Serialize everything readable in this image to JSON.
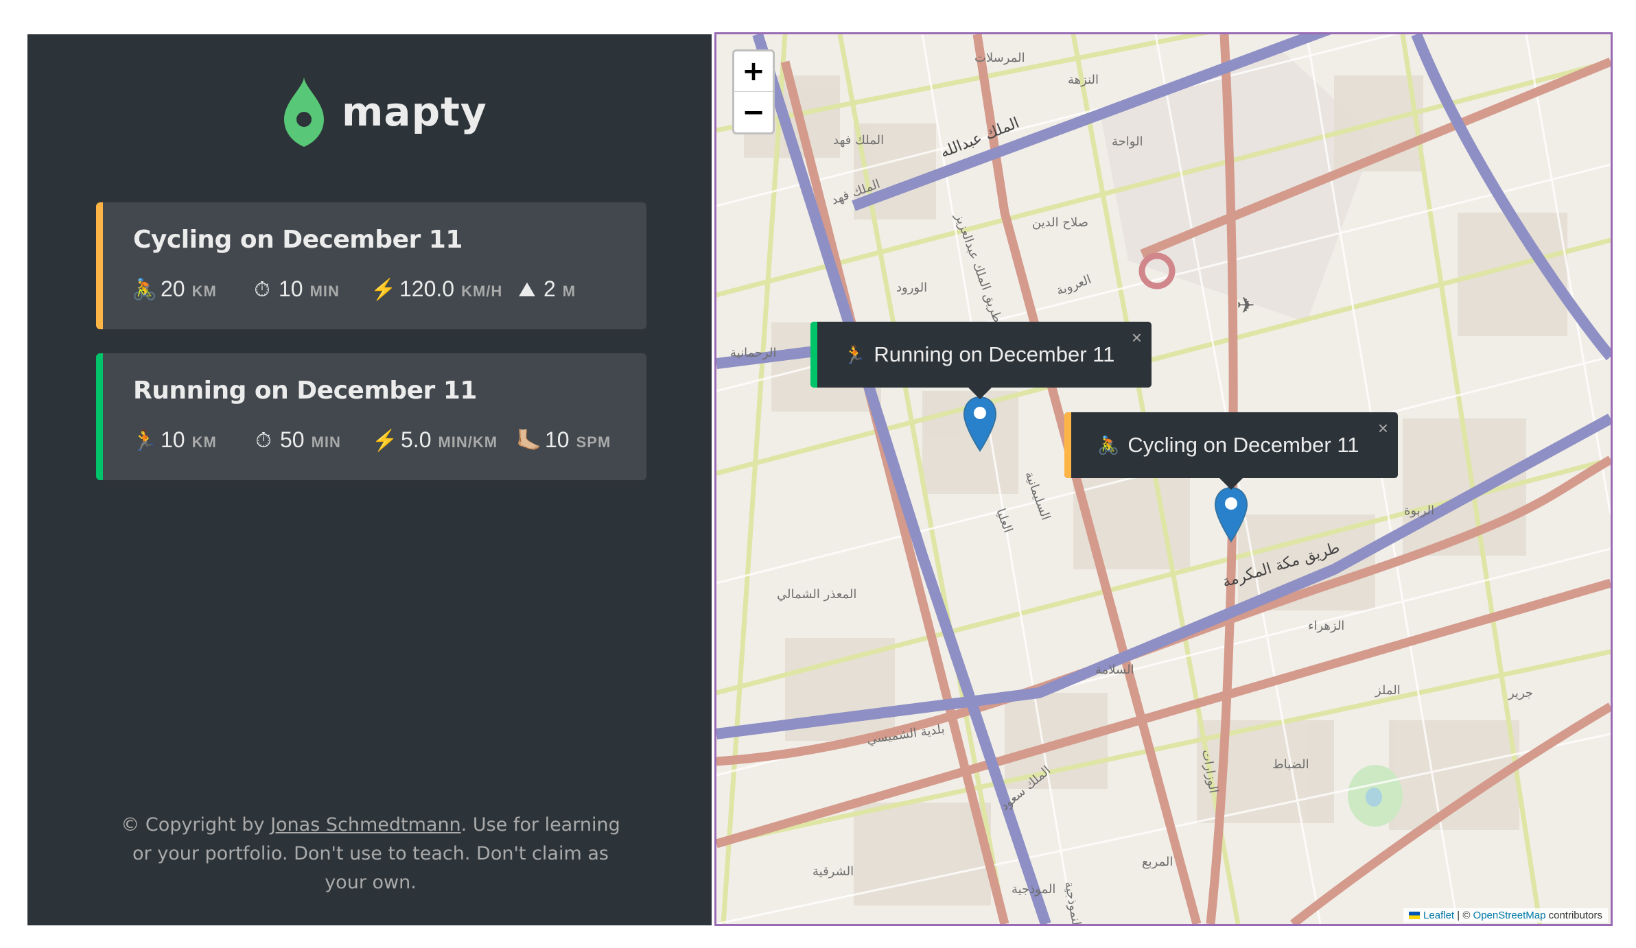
{
  "logo": {
    "text": "mapty",
    "pin_color": "#58c777"
  },
  "colors": {
    "sidebar_bg": "#2d3439",
    "card_bg": "#42484d",
    "cycling_accent": "#ffb545",
    "running_accent": "#00c46a",
    "map_border": "#9a6bb5"
  },
  "workouts": [
    {
      "type": "cycling",
      "title": "Cycling on December 11",
      "details": [
        {
          "icon": "🚴",
          "value": "20",
          "unit": "KM"
        },
        {
          "icon": "⏱",
          "value": "10",
          "unit": "MIN"
        },
        {
          "icon": "⚡️",
          "value": "120.0",
          "unit": "KM/H"
        },
        {
          "icon": "⛰",
          "value": "2",
          "unit": "M"
        }
      ]
    },
    {
      "type": "running",
      "title": "Running on December 11",
      "details": [
        {
          "icon": "🏃",
          "value": "10",
          "unit": "KM"
        },
        {
          "icon": "⏱",
          "value": "50",
          "unit": "MIN"
        },
        {
          "icon": "⚡️",
          "value": "5.0",
          "unit": "MIN/KM"
        },
        {
          "icon": "🦶🏼",
          "value": "10",
          "unit": "SPM"
        }
      ]
    }
  ],
  "copyright": {
    "prefix": "© Copyright by ",
    "author": "Jonas Schmedtmann",
    "suffix": ". Use for learning or your portfolio. Don't use to teach. Don't claim as your own."
  },
  "map": {
    "zoom_in": "+",
    "zoom_out": "−",
    "popups": [
      {
        "icon": "🏃",
        "text": "Running on December 11",
        "close": "×"
      },
      {
        "icon": "🚴",
        "text": "Cycling on December 11",
        "close": "×"
      }
    ],
    "attribution": {
      "leaflet": "Leaflet",
      "separator": " | © ",
      "osm": "OpenStreetMap",
      "suffix": " contributors"
    },
    "labels": [
      "المرسلات",
      "النزهة",
      "الملك فهد",
      "الملك عبدالله",
      "الواحة",
      "صلاح الدين",
      "العروبة",
      "الورود",
      "الرحمانية",
      "الملك فهد",
      "طريق مكة المكرمة",
      "المعذر الشمالي",
      "السلامة",
      "الزهراء",
      "الملز",
      "الضباط",
      "الربوة",
      "بلدية الشميسي",
      "الشرقية",
      "الموذجية",
      "المربع",
      "جرير",
      "العليا",
      "السليمانية",
      "الملك سعود",
      "النموذجية",
      "الوزارات",
      "طريق الملك عبدالعزيز"
    ]
  }
}
